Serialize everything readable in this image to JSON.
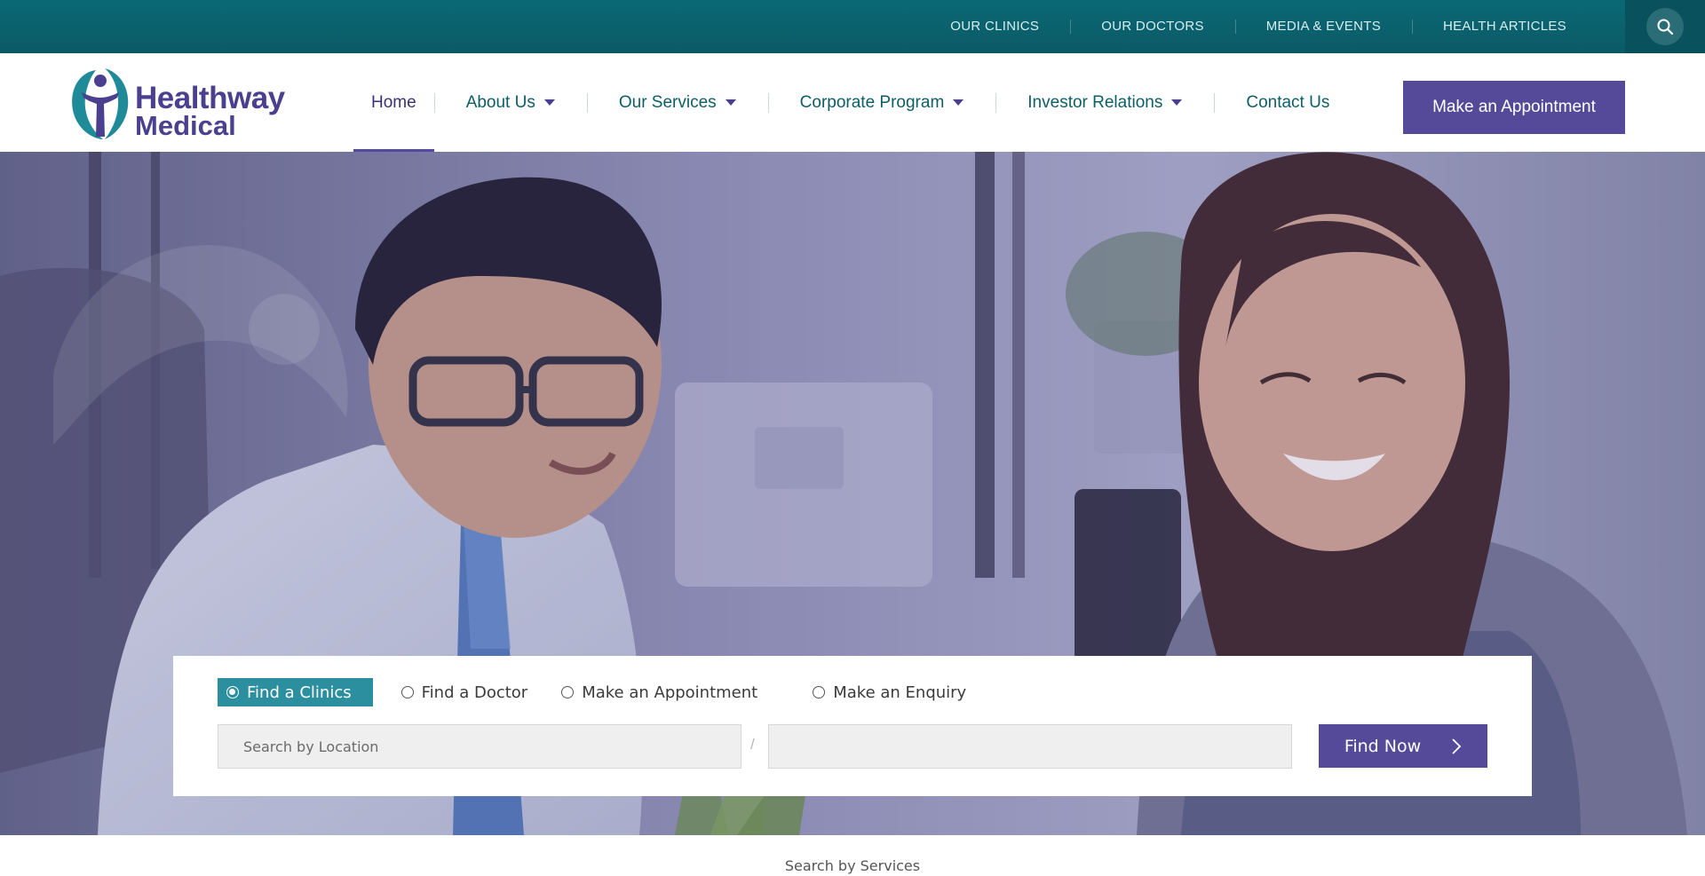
{
  "top_nav": {
    "links": [
      "OUR CLINICS",
      "OUR DOCTORS",
      "MEDIA & EVENTS",
      "HEALTH ARTICLES"
    ],
    "search_icon": "search-icon"
  },
  "brand": {
    "line1": "Healthway",
    "line2": "Medical",
    "colors": {
      "teal": "#1f8a98",
      "purple": "#4b3f8f"
    }
  },
  "main_nav": {
    "items": [
      {
        "label": "Home",
        "active": true,
        "has_dropdown": false
      },
      {
        "label": "About Us",
        "has_dropdown": true
      },
      {
        "label": "Our Services",
        "has_dropdown": true
      },
      {
        "label": "Corporate Program",
        "has_dropdown": true
      },
      {
        "label": "Investor Relations",
        "has_dropdown": true
      },
      {
        "label": "Contact Us",
        "has_dropdown": false
      }
    ],
    "appointment_button": "Make an Appointment"
  },
  "search_panel": {
    "options": [
      {
        "label": "Find a Clinics",
        "selected": true
      },
      {
        "label": "Find a Doctor",
        "selected": false
      },
      {
        "label": "Make an Appointment",
        "selected": false
      },
      {
        "label": "Make an Enquiry",
        "selected": false
      }
    ],
    "location_placeholder": "Search by Location",
    "second_field_value": "",
    "separator": "/",
    "find_button": "Find Now"
  },
  "below_panel_label": "Search by Services",
  "colors": {
    "topbar": "#0a6975",
    "accent_purple": "#554a9a",
    "selected_tab": "#2c8f9f",
    "nav_text": "#0c5e66"
  }
}
